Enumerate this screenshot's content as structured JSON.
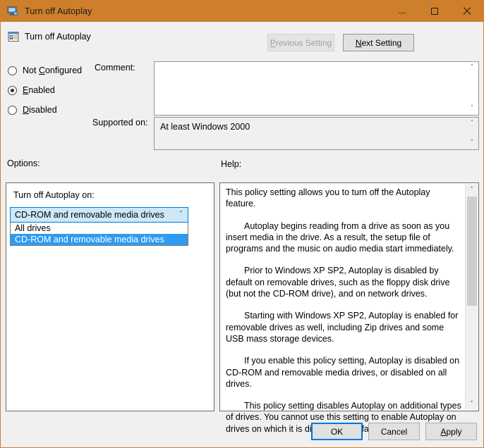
{
  "window": {
    "title": "Turn off Autoplay",
    "accent_color": "#cd7f2b",
    "icon": "computer-policy-icon",
    "controls": {
      "minimize": "minimize-icon",
      "maximize": "maximize-icon",
      "close": "close-icon"
    }
  },
  "header": {
    "title": "Turn off Autoplay",
    "icon": "policy-setting-icon",
    "previous_setting": "Previous Setting",
    "previous_accel": "P",
    "next_setting": "Next Setting",
    "next_accel": "N"
  },
  "state_radios": [
    {
      "label": "Not Configured",
      "accel": "C",
      "checked": false
    },
    {
      "label": "Enabled",
      "accel": "E",
      "checked": true
    },
    {
      "label": "Disabled",
      "accel": "D",
      "checked": false
    }
  ],
  "fields": {
    "comment_label": "Comment:",
    "comment_value": "",
    "supported_label": "Supported on:",
    "supported_value": "At least Windows 2000"
  },
  "sections": {
    "options_label": "Options:",
    "help_label": "Help:"
  },
  "options": {
    "combo_label": "Turn off Autoplay on:",
    "combo_value": "CD-ROM and removable media drives",
    "dropdown_open": true,
    "dropdown_items": [
      {
        "label": "All drives",
        "selected": false
      },
      {
        "label": "CD-ROM and removable media drives",
        "selected": true
      }
    ],
    "highlight_color": "#2e9bf0",
    "focus_color": "#0078d7"
  },
  "help": {
    "paragraphs": [
      "This policy setting allows you to turn off the Autoplay feature.",
      "Autoplay begins reading from a drive as soon as you insert media in the drive. As a result, the setup file of programs and the music on audio media start immediately.",
      "Prior to Windows XP SP2, Autoplay is disabled by default on removable drives, such as the floppy disk drive (but not the CD-ROM drive), and on network drives.",
      "Starting with Windows XP SP2, Autoplay is enabled for removable drives as well, including Zip drives and some USB mass storage devices.",
      "If you enable this policy setting, Autoplay is disabled on CD-ROM and removable media drives, or disabled on all drives.",
      "This policy setting disables Autoplay on additional types of drives. You cannot use this setting to enable Autoplay on drives on which it is disabled by default."
    ],
    "scroll_up": "˄",
    "scroll_down": "˅"
  },
  "buttons": {
    "ok": "OK",
    "cancel": "Cancel",
    "apply": "Apply",
    "apply_accel": "A"
  },
  "scroll_glyphs": {
    "up": "˄",
    "down": "˅"
  }
}
